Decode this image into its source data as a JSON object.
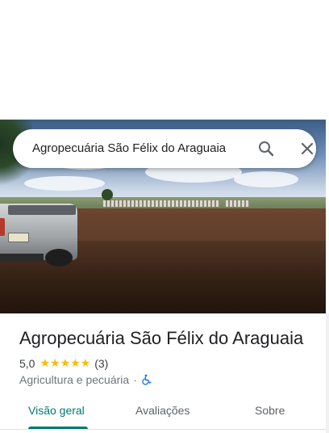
{
  "search": {
    "query": "Agropecuária São Félix do Araguaia",
    "search_icon": "search-icon",
    "close_icon": "close-icon"
  },
  "place": {
    "name": "Agropecuária São Félix do Araguaia",
    "rating": "5,0",
    "stars": "★★★★★",
    "star_count": 5,
    "review_count": "(3)",
    "category": "Agricultura e pecuária",
    "separator": "·",
    "accessibility_icon": "wheelchair-icon"
  },
  "tabs": [
    {
      "label": "Visão geral",
      "active": true
    },
    {
      "label": "Avaliações",
      "active": false
    },
    {
      "label": "Sobre",
      "active": false
    }
  ],
  "colors": {
    "accent": "#01796f",
    "star": "#fbbc04",
    "accessibility": "#1a73e8"
  }
}
